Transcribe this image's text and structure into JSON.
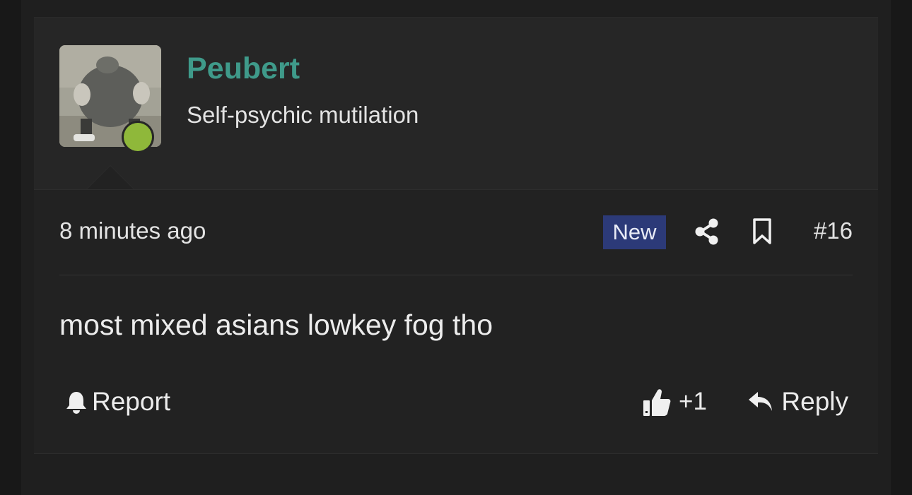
{
  "post": {
    "author": {
      "username": "Peubert",
      "title": "Self-psychic mutilation",
      "status": "online",
      "avatar_icon": "avatar-photo",
      "username_color": "#3f9a8a",
      "online_color": "#8fb83a"
    },
    "meta": {
      "timestamp": "8 minutes ago",
      "badge": "New",
      "badge_color": "#2c3a78",
      "share_icon": "share-icon",
      "bookmark_icon": "bookmark-icon",
      "post_number": "#16"
    },
    "message": "most mixed asians lowkey fog tho",
    "actions": {
      "report_label": "Report",
      "report_icon": "bell-icon",
      "like_count": "+1",
      "like_icon": "thumbs-up-icon",
      "reply_label": "Reply",
      "reply_icon": "reply-arrow-icon"
    }
  }
}
